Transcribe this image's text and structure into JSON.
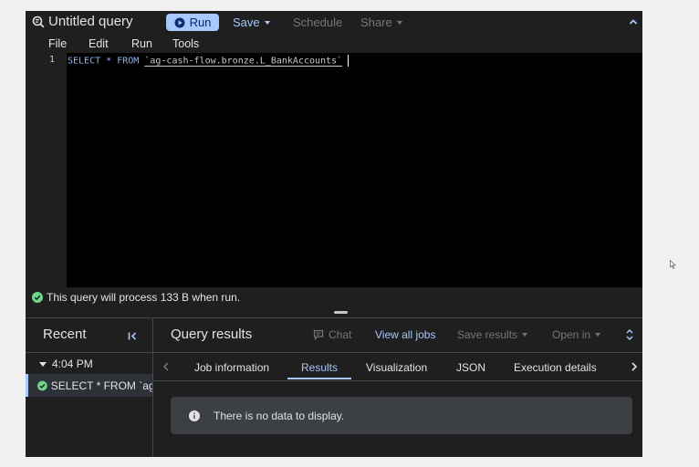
{
  "header": {
    "title": "Untitled query",
    "run_label": "Run",
    "save_label": "Save",
    "schedule_label": "Schedule",
    "share_label": "Share"
  },
  "menu": [
    "File",
    "Edit",
    "Run",
    "Tools"
  ],
  "editor": {
    "line_number": "1",
    "keyword_select": "SELECT",
    "star": "*",
    "keyword_from": "FROM",
    "table_ref": "`ag-cash-flow.bronze.L_BankAccounts`"
  },
  "validator": {
    "message": "This query will process 133 B when run."
  },
  "recent": {
    "title": "Recent",
    "group_time": "4:04 PM",
    "entry_label": "SELECT * FROM `ag..."
  },
  "results": {
    "title": "Query results",
    "chat_label": "Chat",
    "view_jobs_label": "View all jobs",
    "save_results_label": "Save results",
    "open_in_label": "Open in",
    "tabs": [
      "Job information",
      "Results",
      "Visualization",
      "JSON",
      "Execution details"
    ],
    "active_tab": "Results",
    "empty_message": "There is no data to display."
  },
  "colors": {
    "accent": "#a8c7fa",
    "success": "#6dd58c",
    "editor_bg": "#000000",
    "panel_bg": "#1f1f1f"
  },
  "icons": [
    "query-icon",
    "play-icon",
    "chevron-up-icon",
    "check-circle-icon",
    "collapse-left-icon",
    "chat-icon",
    "expand-vertical-icon",
    "chevron-left-icon",
    "chevron-right-icon",
    "info-icon",
    "mouse-pointer-icon"
  ]
}
